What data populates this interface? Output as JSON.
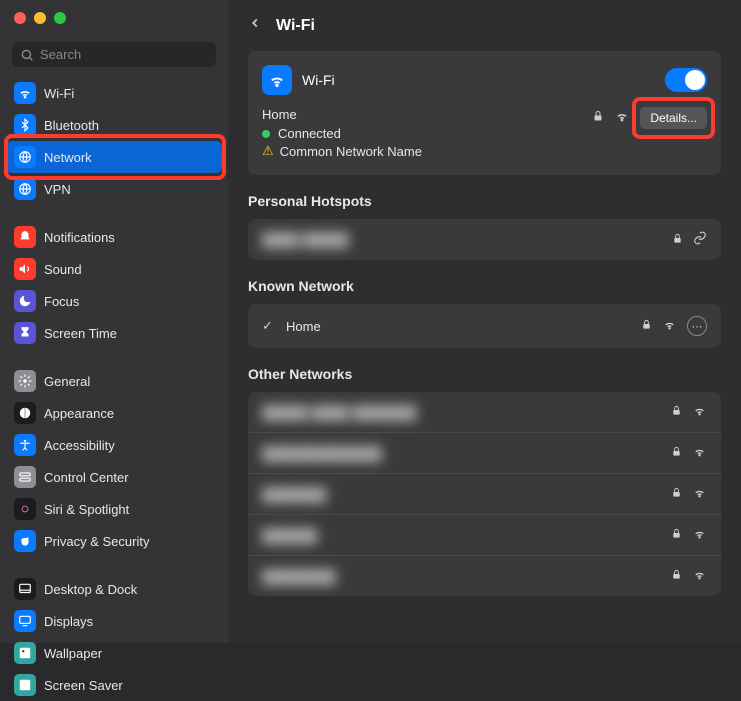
{
  "window": {
    "title": "Wi-Fi"
  },
  "search": {
    "placeholder": "Search"
  },
  "sidebar": {
    "groups": [
      [
        {
          "label": "Wi-Fi",
          "icon": "wifi",
          "color": "icon-blue"
        },
        {
          "label": "Bluetooth",
          "icon": "bluetooth",
          "color": "icon-blue"
        },
        {
          "label": "Network",
          "icon": "globe",
          "color": "icon-blue",
          "selected": true,
          "highlight": true
        },
        {
          "label": "VPN",
          "icon": "globe",
          "color": "icon-blue"
        }
      ],
      [
        {
          "label": "Notifications",
          "icon": "bell",
          "color": "icon-red"
        },
        {
          "label": "Sound",
          "icon": "speaker",
          "color": "icon-red"
        },
        {
          "label": "Focus",
          "icon": "moon",
          "color": "icon-purple"
        },
        {
          "label": "Screen Time",
          "icon": "hourglass",
          "color": "icon-purple"
        }
      ],
      [
        {
          "label": "General",
          "icon": "gear",
          "color": "icon-gray"
        },
        {
          "label": "Appearance",
          "icon": "appearance",
          "color": "icon-black"
        },
        {
          "label": "Accessibility",
          "icon": "accessibility",
          "color": "icon-blue"
        },
        {
          "label": "Control Center",
          "icon": "switches",
          "color": "icon-gray"
        },
        {
          "label": "Siri & Spotlight",
          "icon": "siri",
          "color": "icon-black"
        },
        {
          "label": "Privacy & Security",
          "icon": "hand",
          "color": "icon-blue"
        }
      ],
      [
        {
          "label": "Desktop & Dock",
          "icon": "dock",
          "color": "icon-black"
        },
        {
          "label": "Displays",
          "icon": "display",
          "color": "icon-blue"
        },
        {
          "label": "Wallpaper",
          "icon": "wallpaper",
          "color": "icon-teal"
        },
        {
          "label": "Screen Saver",
          "icon": "screensaver",
          "color": "icon-teal"
        }
      ]
    ]
  },
  "main": {
    "panel_title": "Wi-Fi",
    "toggle_on": true,
    "network": {
      "name": "Home",
      "status": "Connected",
      "warning": "Common Network Name",
      "details_label": "Details..."
    },
    "hotspots": {
      "title": "Personal Hotspots",
      "items": [
        {
          "name": "████ █████",
          "locked": true,
          "linkable": true
        }
      ]
    },
    "known": {
      "title": "Known Network",
      "items": [
        {
          "name": "Home",
          "checked": true,
          "locked": true
        }
      ]
    },
    "other": {
      "title": "Other Networks",
      "items": [
        {
          "name": "█████ ████ ███████",
          "locked": true
        },
        {
          "name": "█████████████",
          "locked": true
        },
        {
          "name": "███████",
          "locked": true
        },
        {
          "name": "██████",
          "locked": true
        },
        {
          "name": "████████",
          "locked": true
        }
      ]
    }
  }
}
